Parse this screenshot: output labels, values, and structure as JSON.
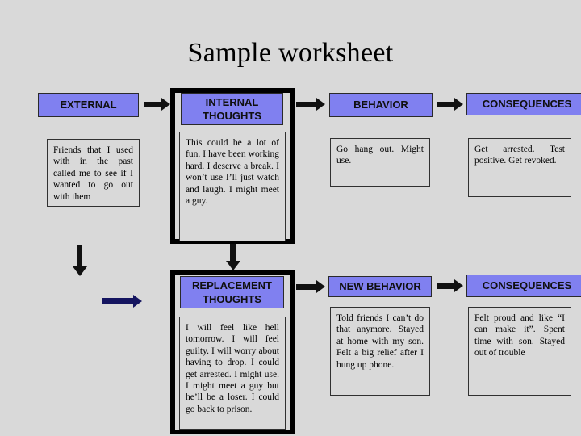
{
  "page": {
    "title": "Sample worksheet",
    "background_color": "#d9d9d9",
    "header_fill_color": "#8080f0",
    "arrow_color": "#111111",
    "navy_arrow_color": "#151560"
  },
  "row_top": {
    "headers": {
      "external": "EXTERNAL",
      "internal_thoughts_line1": "INTERNAL",
      "internal_thoughts_line2": "THOUGHTS",
      "behavior": "BEHAVIOR",
      "consequences": "CONSEQUENCES"
    },
    "cells": {
      "external": "Friends that I used with in the past called me to see if I wanted to go out with them",
      "internal_thoughts": "This could be a lot of fun. I have been working hard. I deserve a break. I won’t use I’ll just watch and laugh. I might meet a guy.",
      "behavior": "Go hang out. Might use.",
      "consequences": "Get arrested. Test positive. Get revoked."
    }
  },
  "row_bottom": {
    "headers": {
      "replacement_thoughts_line1": "REPLACEMENT",
      "replacement_thoughts_line2": "THOUGHTS",
      "new_behavior": "NEW BEHAVIOR",
      "consequences": "CONSEQUENCES"
    },
    "cells": {
      "replacement_thoughts": "I will feel like hell tomorrow. I will feel guilty. I will worry about having to drop. I could get arrested. I might use. I might meet a guy but he’ll be a loser. I could go back to prison.",
      "new_behavior": "Told friends I can’t do that anymore. Stayed at home with my son. Felt a big relief after I hung up phone.",
      "consequences": "Felt proud and like “I can make it”. Spent time with son. Stayed out of trouble"
    }
  },
  "connectors": [
    {
      "name": "external-to-internal-arrow",
      "direction": "right"
    },
    {
      "name": "internal-to-behavior-arrow",
      "direction": "right"
    },
    {
      "name": "behavior-to-consequences-arrow",
      "direction": "right"
    },
    {
      "name": "external-down-arrow",
      "direction": "down"
    },
    {
      "name": "external-restart-arrow",
      "direction": "right",
      "color": "#151560"
    },
    {
      "name": "internal-to-replacement-arrow",
      "direction": "down"
    },
    {
      "name": "replacement-to-new-behavior-arrow",
      "direction": "right"
    },
    {
      "name": "new-behavior-to-consequences-arrow",
      "direction": "right"
    }
  ]
}
